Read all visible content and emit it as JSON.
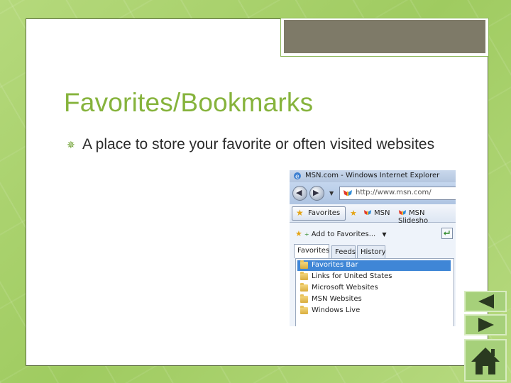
{
  "slide": {
    "title": "Favorites/Bookmarks",
    "bullet_text": "A place to store your favorite or often visited websites",
    "accent_color": "#86b33c",
    "background_color": "#a6cf6a"
  },
  "screenshot": {
    "window_title": "MSN.com - Windows Internet Explorer",
    "address": "http://www.msn.com/",
    "favorites_button": "Favorites",
    "favbar_links": [
      "MSN",
      "MSN Slidesho"
    ],
    "add_to_favorites": "Add to Favorites...",
    "tabs": [
      "Favorites",
      "Feeds",
      "History"
    ],
    "active_tab": "Favorites",
    "folders": [
      {
        "label": "Favorites Bar",
        "selected": true
      },
      {
        "label": "Links for United States",
        "selected": false
      },
      {
        "label": "Microsoft Websites",
        "selected": false
      },
      {
        "label": "MSN Websites",
        "selected": false
      },
      {
        "label": "Windows Live",
        "selected": false
      }
    ],
    "selection_color": "#3f86d6"
  },
  "controls": {
    "previous_icon": "triangle-left-icon",
    "next_icon": "triangle-right-icon",
    "home_icon": "house-icon"
  }
}
